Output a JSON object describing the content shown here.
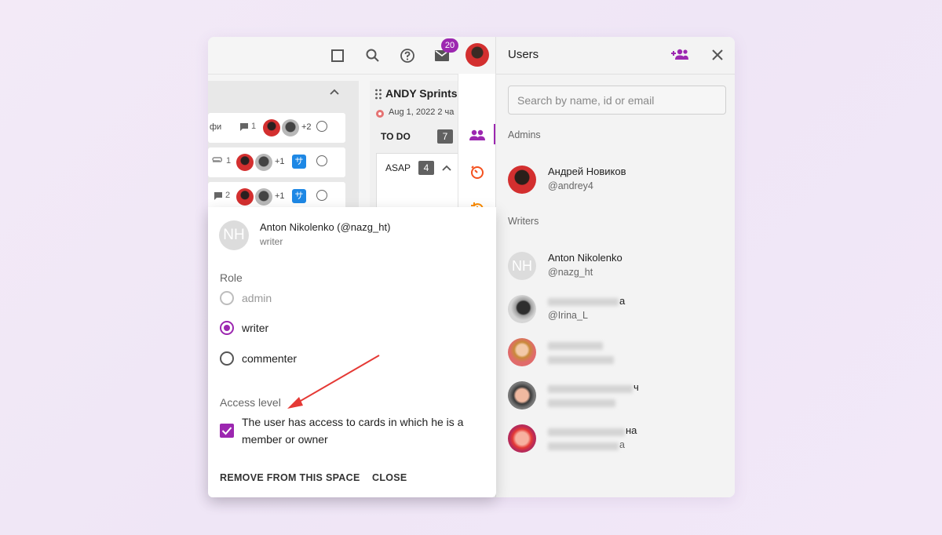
{
  "topbar": {
    "mail_badge": "20"
  },
  "board": {
    "cards": [
      {
        "text": "фи",
        "count": "1",
        "plus": "+2"
      },
      {
        "text": "",
        "count": "1",
        "plus": "+1",
        "tag": "サ"
      },
      {
        "text": "",
        "count": "2",
        "plus": "+1",
        "tag": "サ"
      }
    ],
    "sprint": {
      "title": "ANDY Sprints",
      "date": "Aug 1, 2022 2 ча",
      "todo_label": "TO DO",
      "todo_count": "7",
      "asap_label": "ASAP",
      "asap_count": "4"
    }
  },
  "users_panel": {
    "title": "Users",
    "search_placeholder": "Search by name, id or email",
    "admins_label": "Admins",
    "admins": [
      {
        "name": "Андрей Новиков",
        "handle": "@andrey4"
      }
    ],
    "writers_label": "Writers",
    "writers": [
      {
        "initials": "NH",
        "name": "Anton Nikolenko",
        "handle": "@nazg_ht"
      },
      {
        "name_visible": "а",
        "handle": "@Irina_L"
      },
      {
        "name_visible": "",
        "handle": ""
      },
      {
        "name_visible": "ч",
        "handle": ""
      },
      {
        "name_visible": "на",
        "handle": "а"
      }
    ]
  },
  "popup": {
    "initials": "NH",
    "name": "Anton Nikolenko (@nazg_ht)",
    "role": "writer",
    "role_label": "Role",
    "options": [
      "admin",
      "writer",
      "commenter"
    ],
    "selected": "writer",
    "access_label": "Access level",
    "access_text": "The user has access to cards in which he is a member or owner",
    "access_checked": true,
    "remove_button": "REMOVE FROM THIS SPACE",
    "close_button": "CLOSE"
  },
  "colors": {
    "accent": "#9c27b0",
    "annotation_arrow": "#e53935"
  }
}
